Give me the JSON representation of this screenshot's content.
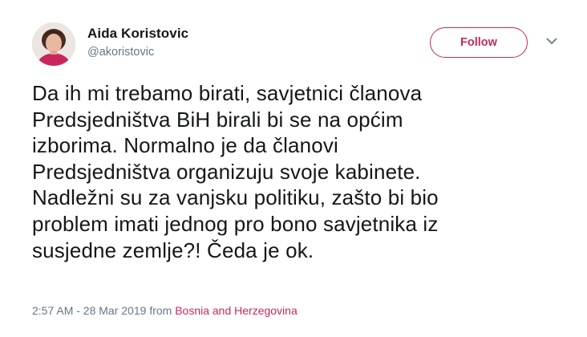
{
  "author": {
    "display_name": "Aida Koristovic",
    "handle": "@akoristovic"
  },
  "follow_button": {
    "label": "Follow"
  },
  "menu": {
    "icon": "chevron-down-icon"
  },
  "tweet": {
    "lines": [
      "Da ih mi trebamo birati, savjetnici članova",
      "Predsjedništva BiH birali bi se na općim",
      "izborima. Normalno je da članovi",
      "Predsjedništva organizuju svoje kabinete.",
      "Nadležni su za vanjsku politiku, zašto bi bio",
      "problem imati jednog pro bono savjetnika iz",
      "susjedne zemlje?! Čeda je ok."
    ]
  },
  "meta": {
    "timestamp": "2:57 AM - 28 Mar 2019",
    "from_label": "from",
    "location": "Bosnia and Herzegovina"
  },
  "colors": {
    "accent": "#c7285f",
    "text": "#14171a",
    "secondary_text": "#657786"
  }
}
